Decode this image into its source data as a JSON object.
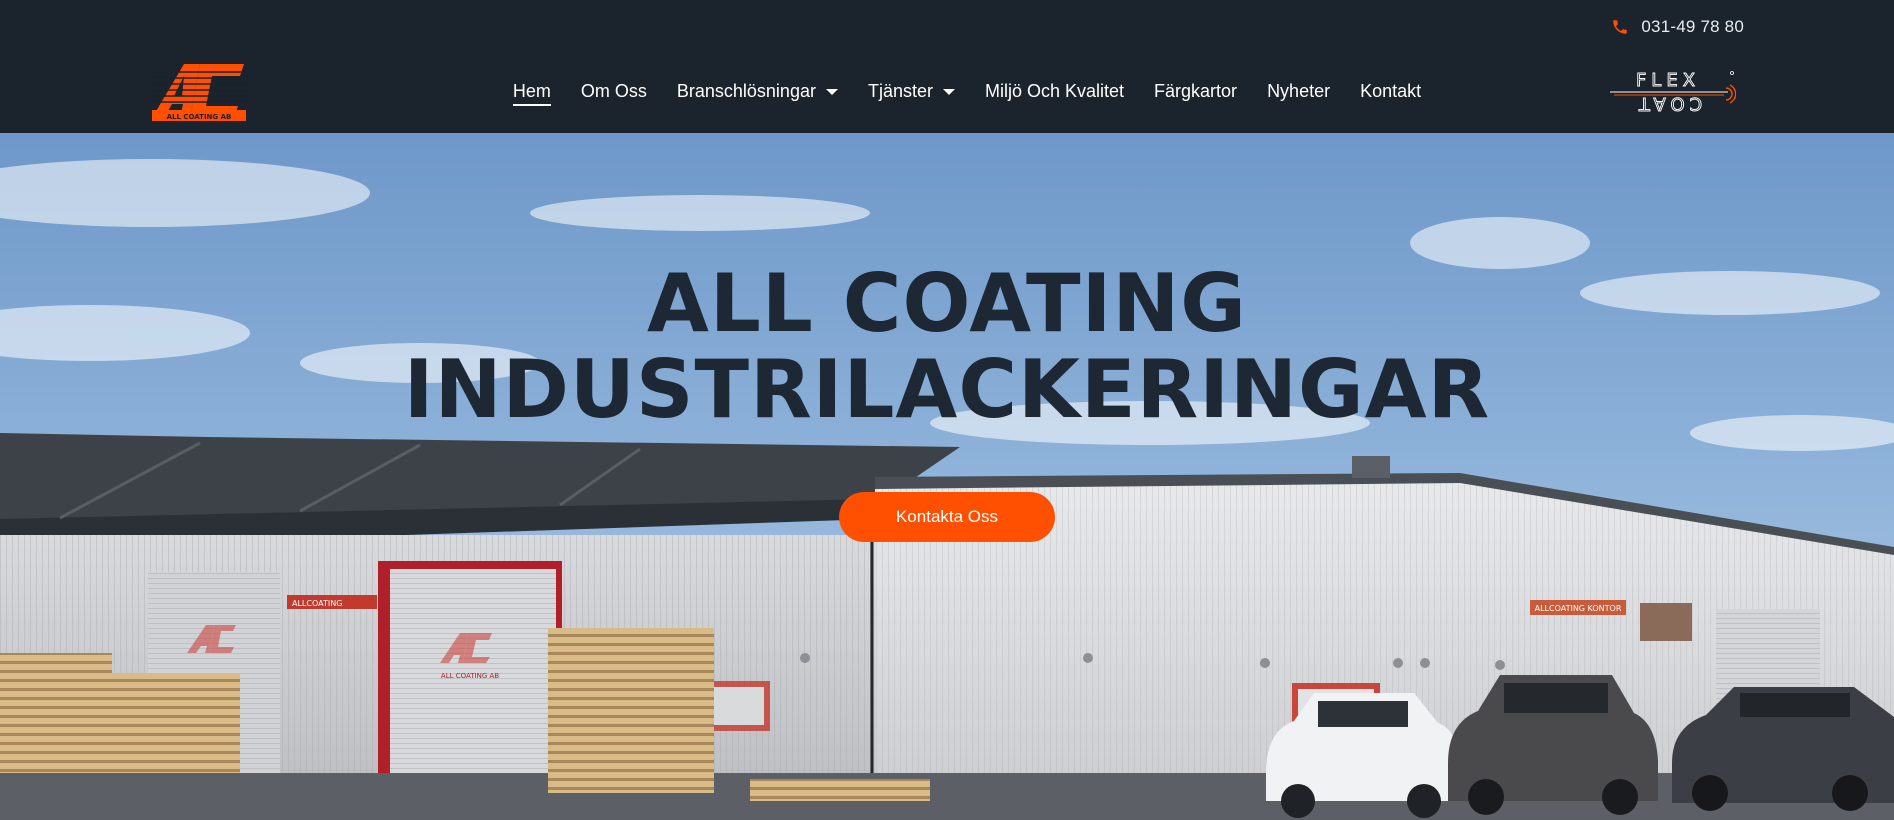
{
  "topbar": {
    "phone": "031-49 78 80",
    "icon": "phone-icon",
    "icon_color": "#ff4f00"
  },
  "brand": {
    "logo_text": "ALL COATING AB",
    "partner_logo_top": "FLEX",
    "partner_logo_bottom": "COAT",
    "accent": "#ff4f00"
  },
  "nav": {
    "items": [
      {
        "label": "Hem",
        "active": true,
        "dropdown": false
      },
      {
        "label": "Om Oss",
        "active": false,
        "dropdown": false
      },
      {
        "label": "Branschlösningar",
        "active": false,
        "dropdown": true
      },
      {
        "label": "Tjänster",
        "active": false,
        "dropdown": true
      },
      {
        "label": "Miljö Och Kvalitet",
        "active": false,
        "dropdown": false
      },
      {
        "label": "Färgkartor",
        "active": false,
        "dropdown": false
      },
      {
        "label": "Nyheter",
        "active": false,
        "dropdown": false
      },
      {
        "label": "Kontakt",
        "active": false,
        "dropdown": false
      }
    ]
  },
  "hero": {
    "title_line1": "ALL COATING",
    "title_line2": "INDUSTRILACKERINGAR",
    "cta_label": "Kontakta Oss",
    "sign_left": "ALLCOATING",
    "sign_right": "ALLCOATING KONTOR",
    "door_logo_text": "ALL COATING AB"
  },
  "colors": {
    "header_bg": "#1b232d",
    "cta_bg": "#ff4f00",
    "title": "#1e2834"
  }
}
